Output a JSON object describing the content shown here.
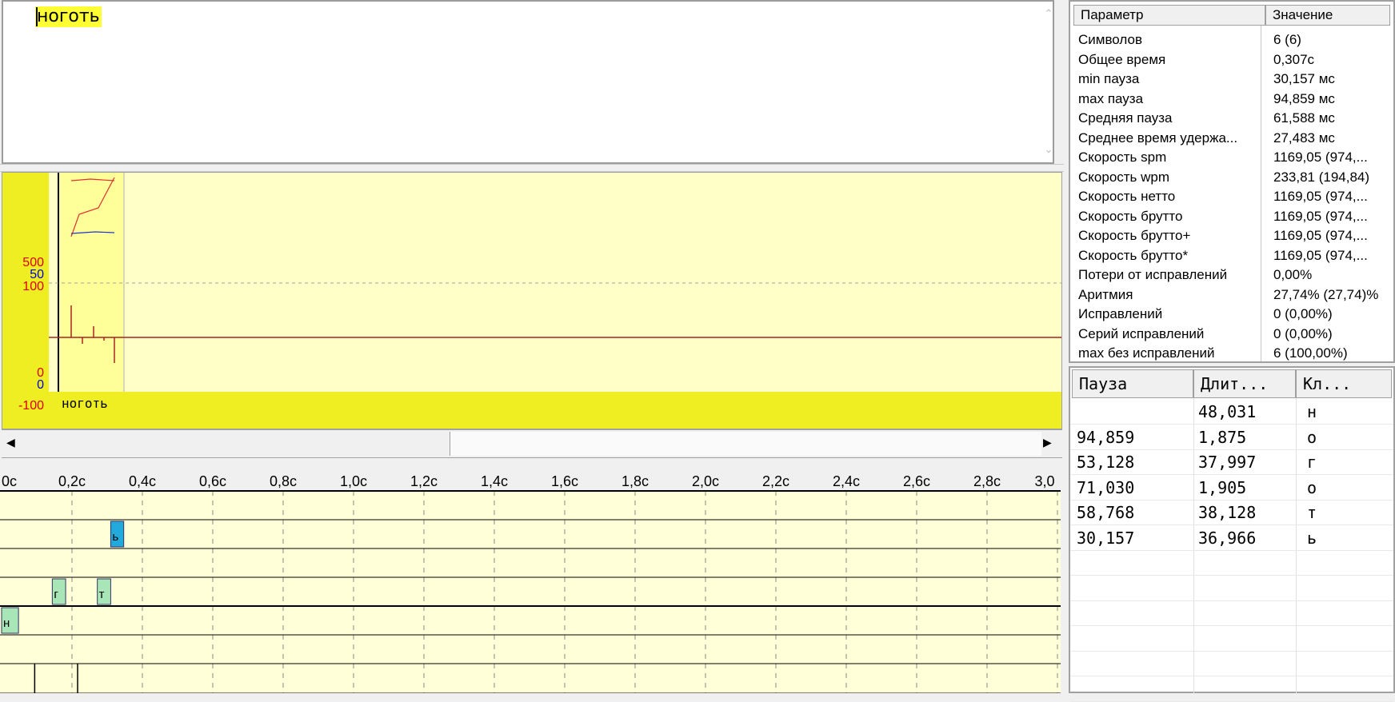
{
  "editor": {
    "typed_text": "ноготь"
  },
  "graph": {
    "axis_labels": {
      "red_500": "500",
      "blue_50": "50",
      "red_100": "100",
      "red_0": "0",
      "blue_0": "0",
      "red_m100": "-100"
    },
    "word": "ноготь"
  },
  "timeline": {
    "ticks": [
      "0c",
      "0,2c",
      "0,4c",
      "0,6c",
      "0,8c",
      "1,0c",
      "1,2c",
      "1,4c",
      "1,6c",
      "1,8c",
      "2,0c",
      "2,2c",
      "2,4c",
      "2,6c",
      "2,8c",
      "3,0"
    ],
    "keys": [
      {
        "char": "н",
        "row": 4,
        "start": 0.0,
        "dur": 0.048,
        "color": "#a8e6b8"
      },
      {
        "char": "г",
        "row": 3,
        "start": 0.144,
        "dur": 0.038,
        "color": "#a8e6b8"
      },
      {
        "char": "т",
        "row": 3,
        "start": 0.272,
        "dur": 0.038,
        "color": "#a8e6b8"
      },
      {
        "char": "ь",
        "row": 1,
        "start": 0.31,
        "dur": 0.037,
        "color": "#22aadd"
      }
    ],
    "markers": [
      0.094,
      0.216
    ]
  },
  "params": {
    "header": {
      "param": "Параметр",
      "value": "Значение"
    },
    "rows": [
      {
        "name": "Символов",
        "value": "6 (6)"
      },
      {
        "name": "Общее время",
        "value": "0,307с"
      },
      {
        "name": "min пауза",
        "value": "30,157 мс"
      },
      {
        "name": "max пауза",
        "value": "94,859 мс"
      },
      {
        "name": "Средняя пауза",
        "value": "61,588 мс"
      },
      {
        "name": "Среднее время удержа...",
        "value": "27,483 мс"
      },
      {
        "name": "Скорость spm",
        "value": "1169,05 (974,..."
      },
      {
        "name": "Скорость wpm",
        "value": "233,81 (194,84)"
      },
      {
        "name": "Скорость нетто",
        "value": "1169,05 (974,..."
      },
      {
        "name": "Скорость брутто",
        "value": "1169,05 (974,..."
      },
      {
        "name": "Скорость брутто+",
        "value": "1169,05 (974,..."
      },
      {
        "name": "Скорость брутто*",
        "value": "1169,05 (974,..."
      },
      {
        "name": "Потери от исправлений",
        "value": "0,00%"
      },
      {
        "name": "Аритмия",
        "value": "27,74% (27,74)%"
      },
      {
        "name": "Исправлений",
        "value": "0 (0,00%)"
      },
      {
        "name": "Серий исправлений",
        "value": "0 (0,00%)"
      },
      {
        "name": "max без исправлений",
        "value": "6 (100,00%)"
      }
    ]
  },
  "pauses": {
    "header": {
      "pause": "Пауза",
      "dur": "Длит...",
      "key": "Кл..."
    },
    "rows": [
      {
        "pause": "",
        "dur": "48,031",
        "key": "н"
      },
      {
        "pause": "94,859",
        "dur": "1,875",
        "key": "о"
      },
      {
        "pause": "53,128",
        "dur": "37,997",
        "key": "г"
      },
      {
        "pause": "71,030",
        "dur": "1,905",
        "key": "о"
      },
      {
        "pause": "58,768",
        "dur": "38,128",
        "key": "т"
      },
      {
        "pause": "30,157",
        "dur": "36,966",
        "key": "ь"
      }
    ]
  }
}
